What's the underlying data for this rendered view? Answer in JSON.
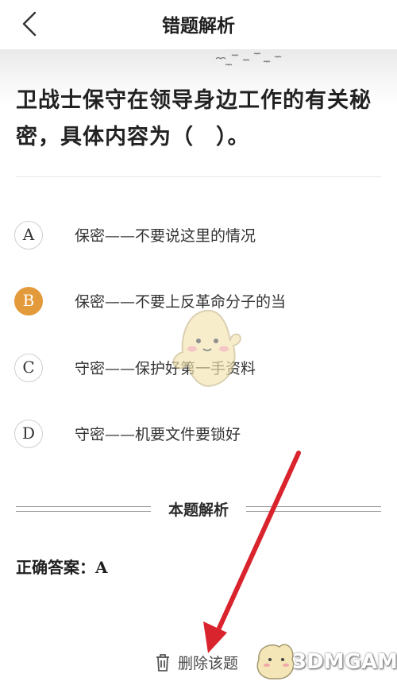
{
  "header": {
    "title": "错题解析",
    "back_icon": "chevron-left-icon"
  },
  "question": {
    "text": "卫战士保守在领导身边工作的有关秘密，具体内容为（　）。"
  },
  "options": [
    {
      "letter": "A",
      "text": "保密——不要说这里的情况",
      "selected": false
    },
    {
      "letter": "B",
      "text": "保密——不要上反革命分子的当",
      "selected": true
    },
    {
      "letter": "C",
      "text": "守密——保护好第一手资料",
      "selected": false
    },
    {
      "letter": "D",
      "text": "守密——机要文件要锁好",
      "selected": false
    }
  ],
  "analysis": {
    "section_title": "本题解析",
    "answer": "正确答案：A"
  },
  "footer": {
    "delete_label": "删除该题",
    "delete_icon": "trash-icon"
  },
  "watermark": {
    "text": "3DMGAME"
  },
  "colors": {
    "selected": "#e39a3a",
    "arrow": "#d9232d"
  }
}
